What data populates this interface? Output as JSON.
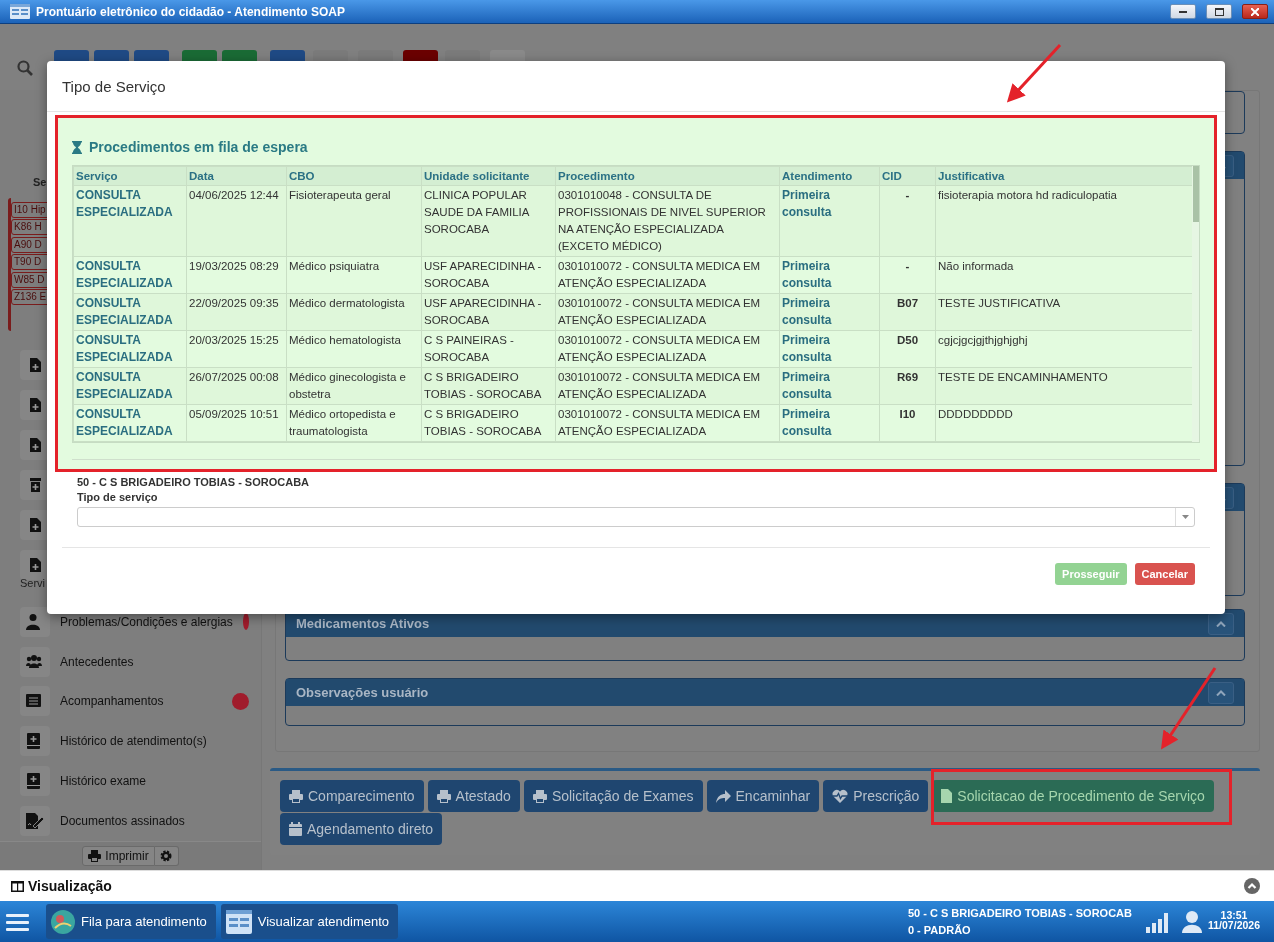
{
  "window": {
    "title": "Prontuário eletrônico do cidadão - Atendimento SOAP"
  },
  "toolbar": {
    "buttons": [
      {
        "color": "#1f4a85"
      },
      {
        "color": "#1f4a85"
      },
      {
        "color": "#1f4a85"
      },
      {
        "color": "#1a6b35"
      },
      {
        "color": "#1a6b35"
      },
      {
        "color": "#1f4a85"
      },
      {
        "color": "#7b7b7b"
      },
      {
        "color": "#7b7b7b"
      },
      {
        "color": "#6b0000"
      },
      {
        "color": "#7b7b7b"
      },
      {
        "color": "#8a8a8a"
      }
    ]
  },
  "sidebar": {
    "heading": "Se",
    "problem_tags": [
      "I10 Hip",
      "K86 H",
      "A90 D",
      "T90 D",
      "W85 D",
      "Z136 E"
    ],
    "partial_label": "Servi",
    "items": [
      {
        "label": "Problemas/Condições e alergias",
        "alert": true
      },
      {
        "label": "Antecedentes",
        "alert": false
      },
      {
        "label": "Acompanhamentos",
        "alert": true
      },
      {
        "label": "Histórico de atendimento(s)",
        "alert": false
      },
      {
        "label": "Histórico exame",
        "alert": false
      },
      {
        "label": "Documentos assinados",
        "alert": false
      }
    ],
    "print_button": "Imprimir"
  },
  "panels": [
    {
      "title": "Medicamentos Ativos"
    },
    {
      "title": "Observações usuário"
    }
  ],
  "actions": [
    {
      "label": "Comparecimento",
      "kind": "print",
      "highlighted": false
    },
    {
      "label": "Atestado",
      "kind": "print",
      "highlighted": false
    },
    {
      "label": "Solicitação de Exames",
      "kind": "print",
      "highlighted": false
    },
    {
      "label": "Encaminhar",
      "kind": "share",
      "highlighted": false
    },
    {
      "label": "Prescrição",
      "kind": "heart",
      "highlighted": false
    },
    {
      "label": "Solicitacao de Procedimento de Serviço",
      "kind": "file",
      "highlighted": true
    },
    {
      "label": "Agendamento direto",
      "kind": "calendar",
      "highlighted": false
    }
  ],
  "dialog": {
    "title": "Tipo de Serviço",
    "queue": {
      "title": "Procedimentos em fila de espera",
      "columns": [
        {
          "label": "Serviço",
          "kind": "link"
        },
        {
          "label": "Data",
          "kind": "text"
        },
        {
          "label": "CBO",
          "kind": "text"
        },
        {
          "label": "Unidade solicitante",
          "kind": "text"
        },
        {
          "label": "Procedimento",
          "kind": "text"
        },
        {
          "label": "Atendimento",
          "kind": "link"
        },
        {
          "label": "CID",
          "kind": "code"
        },
        {
          "label": "Justificativa",
          "kind": "text"
        }
      ],
      "rows": [
        [
          "CONSULTA ESPECIALIZADA",
          "04/06/2025 12:44",
          "Fisioterapeuta geral",
          "CLINICA POPULAR SAUDE DA FAMILIA SOROCABA",
          "0301010048 - CONSULTA DE PROFISSIONAIS DE NIVEL SUPERIOR NA ATENÇÃO ESPECIALIZADA (EXCETO MÉDICO)",
          "Primeira consulta",
          "-",
          "fisioterapia motora hd radiculopatia"
        ],
        [
          "CONSULTA ESPECIALIZADA",
          "19/03/2025 08:29",
          "Médico psiquiatra",
          "USF APARECIDINHA - SOROCABA",
          "0301010072 - CONSULTA MEDICA EM ATENÇÃO ESPECIALIZADA",
          "Primeira consulta",
          "-",
          "Não informada"
        ],
        [
          "CONSULTA ESPECIALIZADA",
          "22/09/2025 09:35",
          "Médico dermatologista",
          "USF APARECIDINHA - SOROCABA",
          "0301010072 - CONSULTA MEDICA EM ATENÇÃO ESPECIALIZADA",
          "Primeira consulta",
          "B07",
          "TESTE JUSTIFICATIVA"
        ],
        [
          "CONSULTA ESPECIALIZADA",
          "20/03/2025 15:25",
          "Médico hematologista",
          "C S PAINEIRAS - SOROCABA",
          "0301010072 - CONSULTA MEDICA EM ATENÇÃO ESPECIALIZADA",
          "Primeira consulta",
          "D50",
          "cgjcjgcjgjthjghjghj"
        ],
        [
          "CONSULTA ESPECIALIZADA",
          "26/07/2025 00:08",
          "Médico ginecologista e obstetra",
          "C S BRIGADEIRO TOBIAS - SOROCABA",
          "0301010072 - CONSULTA MEDICA EM ATENÇÃO ESPECIALIZADA",
          "Primeira consulta",
          "R69",
          "TESTE DE ENCAMINHAMENTO"
        ],
        [
          "CONSULTA ESPECIALIZADA",
          "05/09/2025 10:51",
          "Médico ortopedista e traumatologista",
          "C S BRIGADEIRO TOBIAS - SOROCABA",
          "0301010072 - CONSULTA MEDICA EM ATENÇÃO ESPECIALIZADA",
          "Primeira consulta",
          "I10",
          "DDDDDDDDD"
        ]
      ]
    },
    "unit": "50 - C S BRIGADEIRO TOBIAS - SOROCABA",
    "service_type": {
      "label": "Tipo de serviço"
    },
    "buttons": [
      {
        "label": "Prosseguir",
        "kind": "confirm",
        "disabled": true
      },
      {
        "label": "Cancelar",
        "kind": "cancel",
        "disabled": false
      }
    ]
  },
  "viewer_bar": {
    "title": "Visualização"
  },
  "taskbar": {
    "apps": [
      {
        "label": "Fila para atendimento"
      },
      {
        "label": "Visualizar atendimento"
      }
    ],
    "unit": "50 - C S BRIGADEIRO TOBIAS - SOROCAB",
    "profile": "0 - PADRÃO",
    "time": "13:51",
    "date": "11/07/2026"
  }
}
